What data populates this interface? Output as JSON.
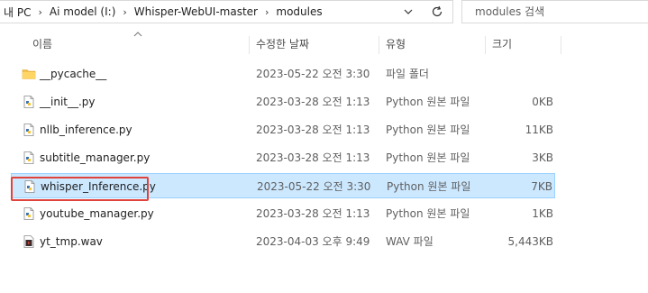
{
  "address": {
    "breadcrumbs": [
      "내 PC",
      "Ai model (I:)",
      "Whisper-WebUI-master",
      "modules"
    ]
  },
  "search": {
    "placeholder": "modules 검색"
  },
  "columns": {
    "name": "이름",
    "date": "수정한 날짜",
    "type": "유형",
    "size": "크기"
  },
  "files": [
    {
      "name": "__pycache__",
      "date": "2023-05-22 오전 3:30",
      "type": "파일 폴더",
      "size": "",
      "icon": "folder-icon"
    },
    {
      "name": "__init__.py",
      "date": "2023-03-28 오전 1:13",
      "type": "Python 원본 파일",
      "size": "0KB",
      "icon": "python-file-icon"
    },
    {
      "name": "nllb_inference.py",
      "date": "2023-03-28 오전 1:13",
      "type": "Python 원본 파일",
      "size": "11KB",
      "icon": "python-file-icon"
    },
    {
      "name": "subtitle_manager.py",
      "date": "2023-03-28 오전 1:13",
      "type": "Python 원본 파일",
      "size": "3KB",
      "icon": "python-file-icon"
    },
    {
      "name": "whisper_Inference.py",
      "date": "2023-05-22 오전 3:30",
      "type": "Python 원본 파일",
      "size": "7KB",
      "icon": "python-file-icon",
      "selected": true
    },
    {
      "name": "youtube_manager.py",
      "date": "2023-03-28 오전 1:13",
      "type": "Python 원본 파일",
      "size": "1KB",
      "icon": "python-file-icon"
    },
    {
      "name": "yt_tmp.wav",
      "date": "2023-04-03 오후 9:49",
      "type": "WAV 파일",
      "size": "5,443KB",
      "icon": "audio-file-icon"
    }
  ],
  "colors": {
    "selection": "#cce8ff",
    "selection_border": "#99d1ff",
    "highlight": "#e0433b",
    "folder": "#f5c14b"
  }
}
